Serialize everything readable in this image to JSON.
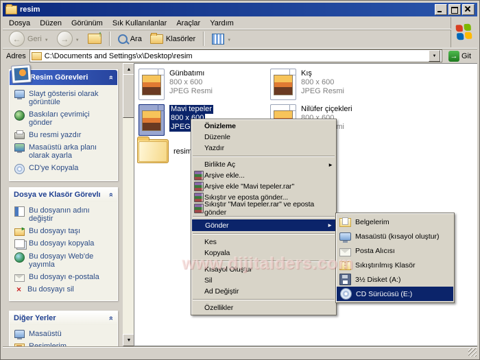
{
  "window": {
    "title": "resim"
  },
  "menubar": {
    "items": [
      "Dosya",
      "Düzen",
      "Görünüm",
      "Sık Kullanılanlar",
      "Araçlar",
      "Yardım"
    ]
  },
  "toolbar": {
    "back_label": "Geri",
    "search_label": "Ara",
    "folders_label": "Klasörler"
  },
  "address": {
    "label": "Adres",
    "value": "C:\\Documents and Settings\\x\\Desktop\\resim",
    "go_label": "Git"
  },
  "sidebar": {
    "picture_tasks": {
      "title": "Resim Görevleri",
      "items": [
        "Slayt gösterisi olarak görüntüle",
        "Baskıları çevrimiçi gönder",
        "Bu resmi yazdır",
        "Masaüstü arka planı olarak ayarla",
        "CD'ye Kopyala"
      ]
    },
    "file_tasks": {
      "title": "Dosya ve Klasör Görevlı",
      "items": [
        "Bu dosyanın adını değiştir",
        "Bu dosyayı taşı",
        "Bu dosyayı kopyala",
        "Bu dosyayı Web'de yayımla",
        "Bu dosyayı e-postala",
        "Bu dosyayı sil"
      ]
    },
    "other_places": {
      "title": "Diğer Yerler",
      "items": [
        "Masaüstü",
        "Resimlerim"
      ]
    }
  },
  "files": {
    "items": [
      {
        "name": "Günbatımı",
        "dimensions": "800 x 600",
        "type": "JPEG Resmi"
      },
      {
        "name": "Kış",
        "dimensions": "800 x 600",
        "type": "JPEG Resmi"
      },
      {
        "name": "Mavi tepeler",
        "dimensions": "800 x 600",
        "type": "JPEG Resmi",
        "selected": true
      },
      {
        "name": "Nilüfer çiçekleri",
        "dimensions": "800 x 600",
        "type": "JPEG Resmi"
      },
      {
        "name": "resim",
        "kind": "folder"
      }
    ]
  },
  "context_menu": {
    "items": [
      "Önizleme",
      "Düzenle",
      "Yazdır",
      "Birlikte Aç",
      "Arşive ekle...",
      "Arşive ekle \"Mavi tepeler.rar\"",
      "Sıkıştır ve eposta gönder...",
      "Sıkıştır \"Mavi tepeler.rar\" ve eposta gönder",
      "Gönder",
      "Kes",
      "Kopyala",
      "Kısayol Oluştur",
      "Sil",
      "Ad Değiştir",
      "Özellikler"
    ]
  },
  "send_to_menu": {
    "items": [
      "Belgelerim",
      "Masaüstü (kısayol oluştur)",
      "Posta Alıcısı",
      "Sıkıştırılmış Klasör",
      "3½ Disket (A:)",
      "CD Sürücüsü (E:)"
    ]
  },
  "watermark": {
    "text": "www.dijitalders.com"
  },
  "colors": {
    "selection": "#0b246a",
    "title_start": "#0d2a7e",
    "title_end": "#2a55ab",
    "task_link": "#2a4a85"
  }
}
